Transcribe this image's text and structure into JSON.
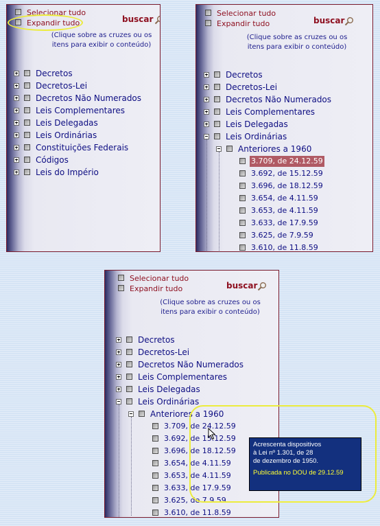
{
  "options": {
    "select_all": "Selecionar tudo",
    "expand_all": "Expandir tudo"
  },
  "search": {
    "label": "buscar",
    "icon": "magnifier-icon"
  },
  "hint": {
    "line1": "(Clique sobre as cruzes ou os",
    "line2": "itens para exibir o conteúdo)"
  },
  "categories": [
    "Decretos",
    "Decretos-Lei",
    "Decretos Não Numerados",
    "Leis Complementares",
    "Leis Delegadas",
    "Leis Ordinárias",
    "Constituições Federais",
    "Códigos",
    "Leis do Império"
  ],
  "subgroup": "Anteriores a 1960",
  "laws": [
    "3.709, de 24.12.59",
    "3.692, de 15.12.59",
    "3.696, de 18.12.59",
    "3.654, de 4.11.59",
    "3.653, de 4.11.59",
    "3.633, de 17.9.59",
    "3.625, de 7.9.59",
    "3.610, de 11.8.59"
  ],
  "laws_bottom": [
    "3.709, de 24.12.59",
    "3.692, de 15.12.59",
    "3.696, de 18.12.59",
    "3.654, de 4.11.59",
    "3.653, de 4.11.59",
    "3.633, de 17.9.59",
    "3.625, de 7.9.59",
    "3.610, de 11.8.59"
  ],
  "tooltip": {
    "line1": "Acrescenta dispositivos",
    "line2": "à Lei nº 1.301, de 28",
    "line3": "de dezembro de 1950.",
    "published": "Publicada no DOU de 29.12.59"
  },
  "colors": {
    "background": "#d5e4f5",
    "panel_border": "#7a1a2c",
    "option_text": "#8e1020",
    "tree_text": "#0d0d82",
    "selected_bg": "#b05a64",
    "tooltip_bg": "#13307e",
    "tooltip_highlight": "#ffff33",
    "annotation": "#ecec3c"
  }
}
